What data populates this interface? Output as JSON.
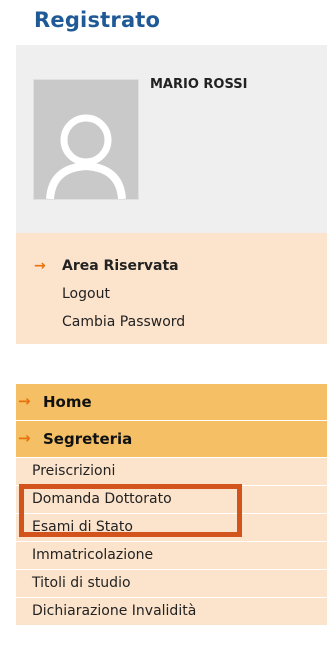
{
  "header": {
    "title": "Registrato"
  },
  "profile": {
    "name": "MARIO ROSSI"
  },
  "reserved_area": {
    "title": "Area Riservata",
    "links": [
      "Logout",
      "Cambia Password"
    ]
  },
  "menu": {
    "home_label": "Home",
    "segreteria_label": "Segreteria",
    "items": [
      "Preiscrizioni",
      "Domanda Dottorato",
      "Esami di Stato",
      "Immatricolazione",
      "Titoli di studio",
      "Dichiarazione Invalidità"
    ]
  },
  "colors": {
    "title_blue": "#1f5a96",
    "header_orange": "#f5c065",
    "item_peach": "#fce4cc",
    "arrow_orange": "#e8720c",
    "highlight_red": "#d2541c"
  },
  "icons": {
    "arrow": "arrow-right-icon",
    "avatar": "user-placeholder-icon"
  }
}
